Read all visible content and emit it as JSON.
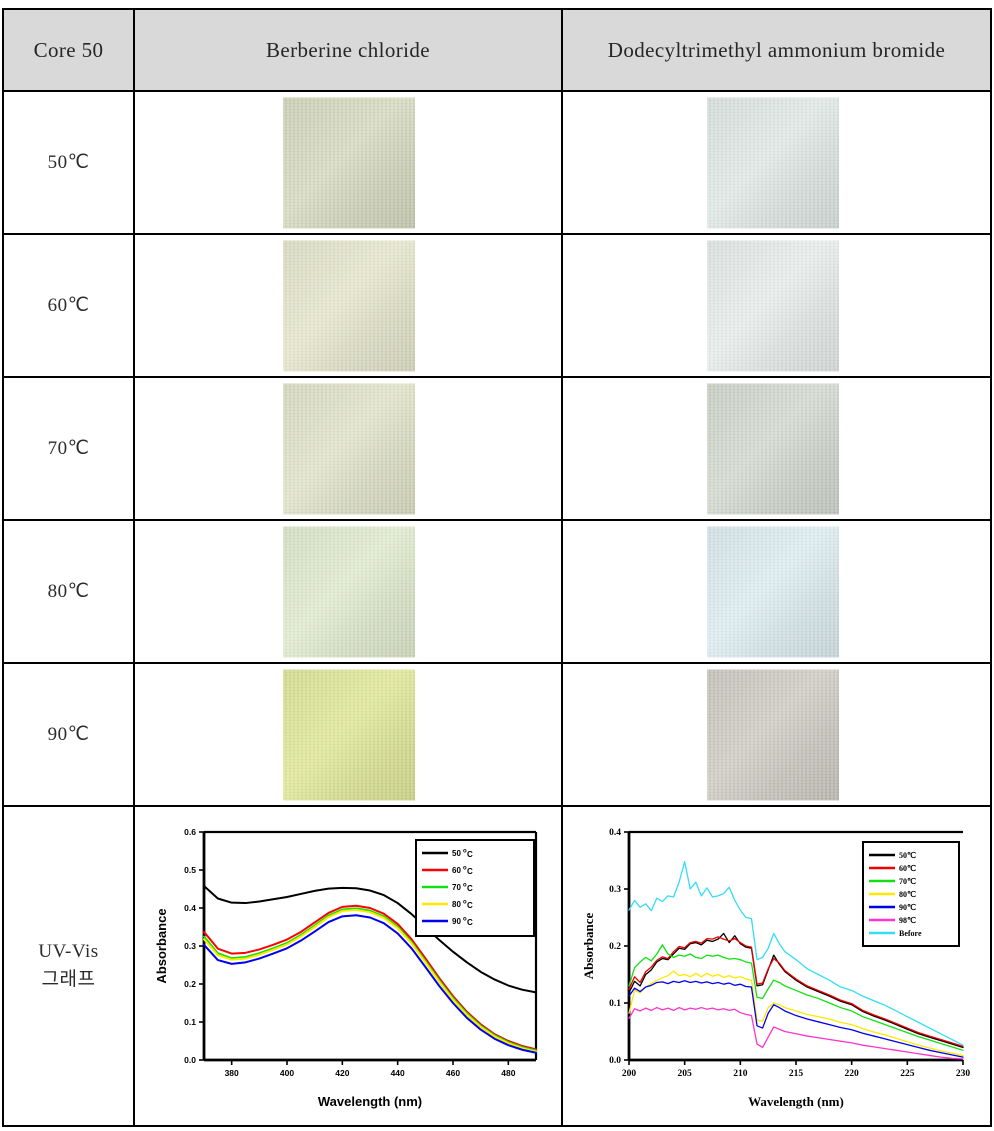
{
  "table": {
    "header": {
      "corner_label": "Core 50",
      "corner_color": "#ff2e2e",
      "col_berberine": "Berberine  chloride",
      "col_dtab": "Dodecyltrimethyl ammonium bromide",
      "background": "#d9d9d9"
    },
    "rows": [
      {
        "temp_label": "50℃",
        "berberine_swatch_color": "#ccd0b6",
        "dtab_swatch_color": "#d6dedb"
      },
      {
        "temp_label": "60℃",
        "berberine_swatch_color": "#dbdcc2",
        "dtab_swatch_color": "#dde2e0"
      },
      {
        "temp_label": "70℃",
        "berberine_swatch_color": "#d6d9bf",
        "dtab_swatch_color": "#c9cfc6"
      },
      {
        "temp_label": "80℃",
        "berberine_swatch_color": "#d6e0c4",
        "dtab_swatch_color": "#d3e2e6"
      },
      {
        "temp_label": "90℃",
        "berberine_swatch_color": "#d5dd8f",
        "dtab_swatch_color": "#c5c2ba"
      }
    ],
    "last_row_label_line1": "UV-Vis",
    "last_row_label_line2": "그래프"
  },
  "chart_data": [
    {
      "id": "berberine-uvvis",
      "type": "line",
      "title": "",
      "xlabel": "Wavelength (nm)",
      "ylabel": "Absorbance",
      "xlim": [
        370,
        490
      ],
      "ylim": [
        0.0,
        0.6
      ],
      "xticks": [
        380,
        400,
        420,
        440,
        460,
        480
      ],
      "yticks": [
        "0.0",
        "0.1",
        "0.2",
        "0.3",
        "0.4",
        "0.5",
        "0.6"
      ],
      "grid": false,
      "legend_position": "top-right",
      "x": [
        370,
        375,
        380,
        385,
        390,
        395,
        400,
        405,
        410,
        415,
        420,
        425,
        430,
        435,
        440,
        445,
        450,
        455,
        460,
        465,
        470,
        475,
        480,
        485,
        490
      ],
      "series": [
        {
          "name": "50 ºC",
          "color": "#000000",
          "values": [
            0.458,
            0.425,
            0.414,
            0.413,
            0.417,
            0.423,
            0.429,
            0.437,
            0.445,
            0.451,
            0.453,
            0.452,
            0.446,
            0.434,
            0.413,
            0.384,
            0.35,
            0.316,
            0.285,
            0.257,
            0.232,
            0.212,
            0.196,
            0.185,
            0.178
          ]
        },
        {
          "name": "60 ºC",
          "color": "#ff0000",
          "values": [
            0.337,
            0.293,
            0.28,
            0.282,
            0.291,
            0.303,
            0.317,
            0.337,
            0.362,
            0.387,
            0.403,
            0.406,
            0.4,
            0.385,
            0.358,
            0.318,
            0.268,
            0.216,
            0.168,
            0.127,
            0.094,
            0.068,
            0.05,
            0.037,
            0.028
          ]
        },
        {
          "name": "70 ºC",
          "color": "#12e012",
          "values": [
            0.325,
            0.281,
            0.268,
            0.271,
            0.281,
            0.294,
            0.308,
            0.329,
            0.354,
            0.38,
            0.396,
            0.399,
            0.393,
            0.378,
            0.351,
            0.311,
            0.261,
            0.21,
            0.163,
            0.123,
            0.09,
            0.065,
            0.047,
            0.034,
            0.025
          ]
        },
        {
          "name": "80 ºC",
          "color": "#ffe800",
          "values": [
            0.318,
            0.276,
            0.264,
            0.267,
            0.277,
            0.29,
            0.304,
            0.325,
            0.35,
            0.376,
            0.392,
            0.395,
            0.389,
            0.374,
            0.347,
            0.307,
            0.257,
            0.206,
            0.159,
            0.119,
            0.087,
            0.062,
            0.044,
            0.031,
            0.022
          ]
        },
        {
          "name": "90 ºC",
          "color": "#0000ee",
          "values": [
            0.303,
            0.263,
            0.253,
            0.257,
            0.267,
            0.28,
            0.294,
            0.314,
            0.338,
            0.363,
            0.378,
            0.381,
            0.375,
            0.36,
            0.333,
            0.294,
            0.245,
            0.195,
            0.15,
            0.111,
            0.08,
            0.056,
            0.039,
            0.027,
            0.019
          ]
        }
      ]
    },
    {
      "id": "dtab-uvvis",
      "type": "line",
      "title": "",
      "xlabel": "Wavelength (nm)",
      "ylabel": "Absorbance",
      "xlim": [
        200,
        230
      ],
      "ylim": [
        0.0,
        0.4
      ],
      "xticks": [
        200,
        205,
        210,
        215,
        220,
        225,
        230
      ],
      "yticks": [
        "0.0",
        "0.1",
        "0.2",
        "0.3",
        "0.4"
      ],
      "grid": false,
      "legend_position": "top-right",
      "x": [
        200,
        200.5,
        201,
        201.5,
        202,
        202.5,
        203,
        203.5,
        204,
        204.5,
        205,
        205.5,
        206,
        206.5,
        207,
        207.5,
        208,
        208.5,
        209,
        209.5,
        210,
        210.5,
        211,
        211.5,
        212,
        212.5,
        213,
        213.5,
        214,
        215,
        216,
        217,
        218,
        219,
        220,
        221,
        222,
        223,
        224,
        225,
        226,
        227,
        228,
        229,
        230
      ],
      "series": [
        {
          "name": "50℃",
          "color": "#000000",
          "values": [
            0.118,
            0.138,
            0.13,
            0.15,
            0.158,
            0.172,
            0.178,
            0.176,
            0.186,
            0.196,
            0.194,
            0.204,
            0.206,
            0.202,
            0.21,
            0.208,
            0.212,
            0.222,
            0.206,
            0.218,
            0.204,
            0.198,
            0.196,
            0.13,
            0.132,
            0.158,
            0.184,
            0.168,
            0.155,
            0.14,
            0.128,
            0.12,
            0.112,
            0.103,
            0.097,
            0.085,
            0.077,
            0.07,
            0.062,
            0.054,
            0.046,
            0.04,
            0.034,
            0.028,
            0.022
          ]
        },
        {
          "name": "60℃",
          "color": "#ee0000",
          "values": [
            0.124,
            0.146,
            0.136,
            0.155,
            0.163,
            0.175,
            0.181,
            0.178,
            0.19,
            0.199,
            0.197,
            0.206,
            0.208,
            0.205,
            0.213,
            0.212,
            0.216,
            0.212,
            0.209,
            0.213,
            0.206,
            0.2,
            0.198,
            0.133,
            0.135,
            0.16,
            0.178,
            0.17,
            0.157,
            0.142,
            0.13,
            0.122,
            0.114,
            0.105,
            0.099,
            0.087,
            0.079,
            0.072,
            0.064,
            0.056,
            0.048,
            0.042,
            0.036,
            0.03,
            0.024
          ]
        },
        {
          "name": "70℃",
          "color": "#12e012",
          "values": [
            0.13,
            0.162,
            0.172,
            0.18,
            0.174,
            0.186,
            0.202,
            0.186,
            0.18,
            0.184,
            0.182,
            0.186,
            0.18,
            0.178,
            0.184,
            0.182,
            0.184,
            0.18,
            0.177,
            0.178,
            0.176,
            0.172,
            0.17,
            0.11,
            0.108,
            0.125,
            0.14,
            0.136,
            0.13,
            0.122,
            0.114,
            0.108,
            0.1,
            0.092,
            0.086,
            0.076,
            0.069,
            0.062,
            0.055,
            0.048,
            0.041,
            0.035,
            0.029,
            0.023,
            0.017
          ]
        },
        {
          "name": "80℃",
          "color": "#ffe800",
          "values": [
            0.082,
            0.122,
            0.118,
            0.128,
            0.134,
            0.14,
            0.144,
            0.148,
            0.156,
            0.148,
            0.15,
            0.146,
            0.152,
            0.146,
            0.152,
            0.147,
            0.15,
            0.145,
            0.148,
            0.144,
            0.146,
            0.142,
            0.14,
            0.07,
            0.068,
            0.092,
            0.1,
            0.097,
            0.092,
            0.086,
            0.08,
            0.076,
            0.072,
            0.066,
            0.062,
            0.055,
            0.049,
            0.044,
            0.038,
            0.032,
            0.026,
            0.021,
            0.016,
            0.012,
            0.008
          ]
        },
        {
          "name": "90℃",
          "color": "#0000ee",
          "values": [
            0.112,
            0.126,
            0.12,
            0.128,
            0.131,
            0.136,
            0.137,
            0.134,
            0.138,
            0.136,
            0.139,
            0.136,
            0.138,
            0.135,
            0.137,
            0.134,
            0.136,
            0.133,
            0.135,
            0.131,
            0.133,
            0.129,
            0.128,
            0.06,
            0.056,
            0.082,
            0.097,
            0.092,
            0.086,
            0.078,
            0.072,
            0.067,
            0.062,
            0.057,
            0.053,
            0.047,
            0.042,
            0.037,
            0.032,
            0.027,
            0.022,
            0.017,
            0.013,
            0.009,
            0.005
          ]
        },
        {
          "name": "98℃",
          "color": "#ff33cc",
          "values": [
            0.073,
            0.09,
            0.086,
            0.091,
            0.087,
            0.092,
            0.088,
            0.091,
            0.087,
            0.092,
            0.088,
            0.091,
            0.089,
            0.092,
            0.089,
            0.091,
            0.088,
            0.09,
            0.087,
            0.089,
            0.083,
            0.08,
            0.078,
            0.028,
            0.022,
            0.04,
            0.058,
            0.054,
            0.05,
            0.046,
            0.042,
            0.039,
            0.036,
            0.033,
            0.03,
            0.026,
            0.023,
            0.02,
            0.017,
            0.014,
            0.011,
            0.008,
            0.005,
            0.003,
            0.002
          ]
        },
        {
          "name": "Before",
          "color": "#33ddf5",
          "values": [
            0.263,
            0.28,
            0.268,
            0.274,
            0.262,
            0.284,
            0.278,
            0.288,
            0.286,
            0.312,
            0.348,
            0.3,
            0.312,
            0.288,
            0.302,
            0.286,
            0.288,
            0.292,
            0.303,
            0.28,
            0.263,
            0.25,
            0.248,
            0.176,
            0.18,
            0.196,
            0.222,
            0.204,
            0.19,
            0.176,
            0.16,
            0.15,
            0.14,
            0.128,
            0.122,
            0.112,
            0.104,
            0.096,
            0.086,
            0.076,
            0.066,
            0.056,
            0.046,
            0.036,
            0.026
          ]
        }
      ]
    }
  ]
}
